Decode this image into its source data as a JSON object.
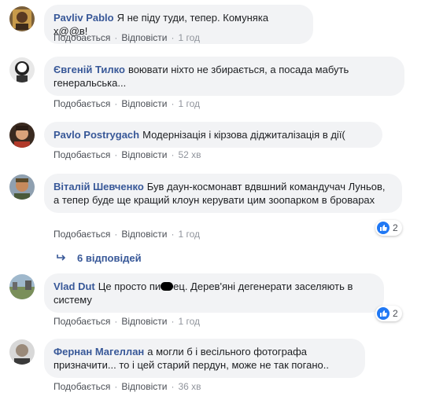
{
  "actions": {
    "like": "Подобається",
    "reply": "Відповісти",
    "separator": "·"
  },
  "comments": [
    {
      "author": "Pavliv Pablo",
      "text": "Я не піду туди, тепер. Комуняка х@@в!",
      "time": "1 год"
    },
    {
      "author": "Євгеній Тилко",
      "text": "воювати ніхто не збирається, а посада мабуть генеральська...",
      "time": "1 год"
    },
    {
      "author": "Pavlo Postrygach",
      "text": "Модернізація і кірзова діджиталізація в дії(",
      "time": "52 хв"
    },
    {
      "author": "Віталій Шевченко",
      "text": "Був даун-космонавт вдвшний командучач Луньов, а тепер буде ще кращий клоун керувати цим зоопарком в броварах",
      "time": "1 год",
      "reactions": "2"
    },
    {
      "author": "Vlad Dut",
      "text_before": "Це просто пи",
      "text_after": "ец. Дерев'яні дегенерати заселяють в систему",
      "time": "1 год",
      "reactions": "2"
    },
    {
      "author": "Фернан Магеллан",
      "text": "а могли б і весільного фотографа призначити... то і цей старий пердун, може не так погано..",
      "time": "36 хв"
    }
  ],
  "replies_link": "6 відповідей",
  "colors": {
    "author": "#385898",
    "bubble": "#f2f3f5",
    "meta": "#90949c",
    "like": "#2078f4"
  },
  "icons": {
    "reaction": "thumbs-up-icon",
    "replies": "reply-arrow-icon"
  }
}
